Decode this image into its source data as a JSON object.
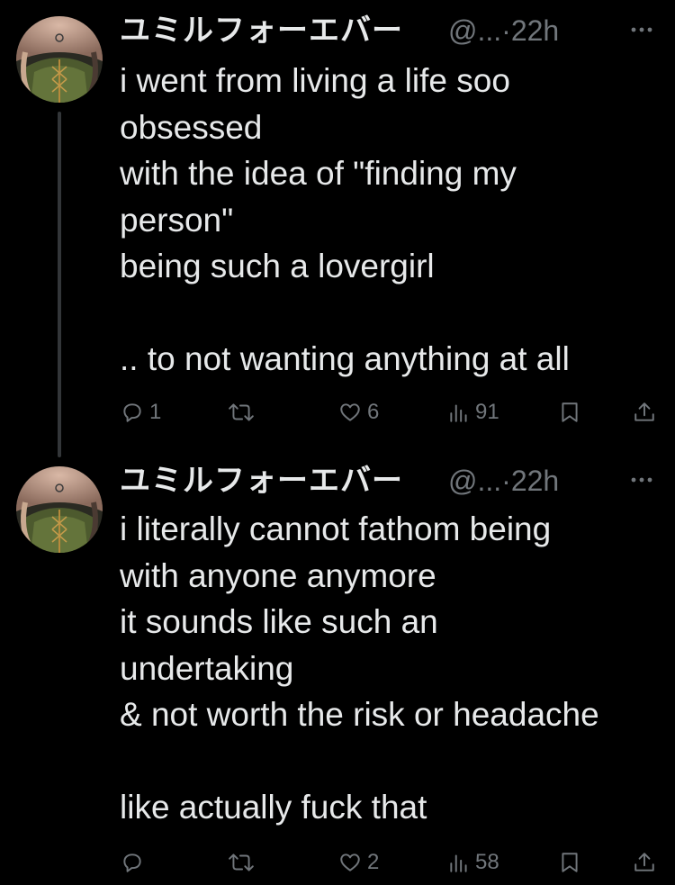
{
  "tweets": [
    {
      "display_name": "ユミルフォーエバー",
      "handle": "@...",
      "separator": "·",
      "time": "22h",
      "text": "i went from living a life soo\nobsessed\nwith the idea of \"finding my\nperson\"\nbeing such a lovergirl\n\n.. to not wanting anything at all",
      "reply_count": "1",
      "retweet_count": "",
      "like_count": "6",
      "view_count": "91"
    },
    {
      "display_name": "ユミルフォーエバー",
      "handle": "@...",
      "separator": "·",
      "time": "22h",
      "text": "i literally cannot fathom being\nwith anyone anymore\nit sounds like such an\nundertaking\n& not worth the risk or headache\n\nlike actually fuck that",
      "reply_count": "",
      "retweet_count": "",
      "like_count": "2",
      "view_count": "58"
    }
  ],
  "colors": {
    "background": "#000000",
    "text_primary": "#e7e9ea",
    "text_secondary": "#71767b",
    "thread_line": "#333639"
  },
  "icons": [
    "avatar",
    "more-icon",
    "reply-icon",
    "retweet-icon",
    "like-icon",
    "views-icon",
    "bookmark-icon",
    "share-icon"
  ]
}
